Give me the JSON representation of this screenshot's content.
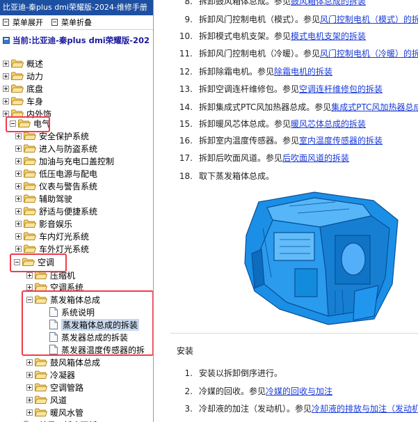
{
  "window": {
    "title": "比亚迪-秦plus dmi荣耀版-2024-维修手册"
  },
  "toolbar": {
    "expand_all": "菜单展开",
    "collapse_all": "菜单折叠"
  },
  "tree": {
    "root": "当前:比亚迪-秦plus dmi荣耀版-202",
    "items": [
      {
        "label": "概述"
      },
      {
        "label": "动力"
      },
      {
        "label": "底盘"
      },
      {
        "label": "车身"
      },
      {
        "label": "内外饰"
      },
      {
        "label": "电气"
      },
      {
        "label": "安全保护系统"
      },
      {
        "label": "进入与防盗系统"
      },
      {
        "label": "加油与充电口盖控制"
      },
      {
        "label": "低压电源与配电"
      },
      {
        "label": "仪表与警告系统"
      },
      {
        "label": "辅助驾驶"
      },
      {
        "label": "舒适与便捷系统"
      },
      {
        "label": "影音娱乐"
      },
      {
        "label": "车内灯光系统"
      },
      {
        "label": "车外灯光系统"
      },
      {
        "label": "空调"
      },
      {
        "label": "压缩机"
      },
      {
        "label": "空调系统"
      },
      {
        "label": "蒸发箱体总成"
      },
      {
        "label": "系统说明"
      },
      {
        "label": "蒸发箱体总成的拆装"
      },
      {
        "label": "蒸发器总成的拆装"
      },
      {
        "label": "蒸发器温度传感器的拆"
      },
      {
        "label": "鼓风箱体总成"
      },
      {
        "label": "冷凝器"
      },
      {
        "label": "空调管路"
      },
      {
        "label": "风道"
      },
      {
        "label": "暖风水管"
      },
      {
        "label": "鼓风...板度面板"
      }
    ]
  },
  "content": {
    "steps": [
      {
        "num": "8.",
        "text": "拆卸鼓风箱体总成。参见",
        "link": "鼓风箱体总成的拆装"
      },
      {
        "num": "9.",
        "text": "拆卸风门控制电机（模式）。参见",
        "link": "风门控制电机（模式）的拆"
      },
      {
        "num": "10.",
        "text": "拆卸模式电机支架。参见",
        "link": "模式电机支架的拆装"
      },
      {
        "num": "11.",
        "text": "拆卸风门控制电机（冷暖）。参见",
        "link": "风门控制电机（冷暖）的拆"
      },
      {
        "num": "12.",
        "text": "拆卸除霜电机。参见",
        "link": "除霜电机的拆装"
      },
      {
        "num": "13.",
        "text": "拆卸空调连杆维修包。参见",
        "link": "空调连杆维修包的拆装"
      },
      {
        "num": "14.",
        "text": "拆卸集成式PTC风加热器总成。参见",
        "link": "集成式PTC风加热器总成"
      },
      {
        "num": "15.",
        "text": "拆卸暖风芯体总成。参见",
        "link": "暖风芯体总成的拆装"
      },
      {
        "num": "16.",
        "text": "拆卸室内温度传感器。参见",
        "link": "室内温度传感器的拆装"
      },
      {
        "num": "17.",
        "text": "拆卸后吹面风道。参见",
        "link": "后吹面风道的拆装"
      },
      {
        "num": "18.",
        "text": "取下蒸发箱体总成。",
        "link": ""
      }
    ],
    "section_title": "安装",
    "install_steps": [
      {
        "num": "1.",
        "text": "安装以拆卸倒序进行。",
        "link": ""
      },
      {
        "num": "2.",
        "text": "冷媒的回收。参见",
        "link": "冷媒的回收与加注"
      },
      {
        "num": "3.",
        "text": "冷却液的加注（发动机）。参见",
        "link": "冷却液的排放与加注（发动机"
      }
    ]
  },
  "colors": {
    "title_bar": "#1d50a2",
    "link": "#1a3bd8",
    "highlight_box": "#f03c4c",
    "selected_row": "#c9d8ee",
    "part_blue": "#1b8fe6"
  }
}
